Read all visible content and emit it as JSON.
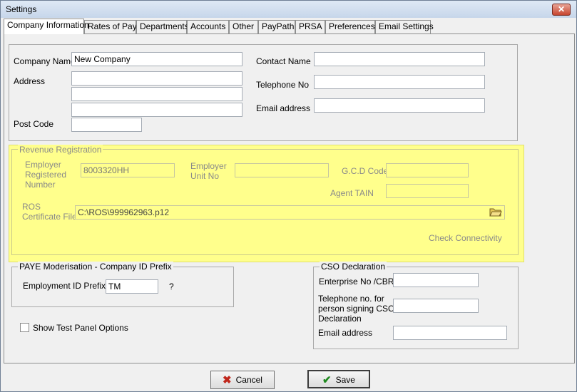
{
  "window": {
    "title": "Settings",
    "close_glyph": "✕"
  },
  "tabs": [
    "Company Information",
    "Rates of Pay",
    "Departments",
    "Accounts",
    "Other",
    "PayPath",
    "PRSA",
    "Preferences",
    "Email Settings"
  ],
  "company": {
    "name_label": "Company Name",
    "name_value": "New Company",
    "address_label": "Address",
    "postcode_label": "Post Code",
    "contact_label": "Contact Name",
    "telephone_label": "Telephone No",
    "email_label": "Email address"
  },
  "revenue": {
    "legend": "Revenue Registration",
    "employer_reg_label_1": "Employer",
    "employer_reg_label_2": "Registered",
    "employer_reg_label_3": "Number",
    "employer_reg_value": "8003320HH",
    "employer_unit_label_1": "Employer",
    "employer_unit_label_2": "Unit No",
    "gcd_label": "G.C.D Code",
    "agent_label": "Agent TAIN",
    "ros_label_1": "ROS",
    "ros_label_2": "Certificate File",
    "ros_value": "C:\\ROS\\999962963.p12",
    "check_connectivity": "Check Connectivity"
  },
  "paye": {
    "legend": "PAYE Moderisation  - Company ID Prefix",
    "prefix_label": "Employment ID Prefix",
    "prefix_value": "TM",
    "help": "?"
  },
  "cso": {
    "legend": "CSO Declaration",
    "enterprise_label": "Enterprise No /CBR",
    "tel_label_1": "Telephone no. for",
    "tel_label_2": "person signing CSO",
    "tel_label_3": "Declaration",
    "email_label": "Email address"
  },
  "options": {
    "show_test_panel": "Show Test Panel Options",
    "show_test_panel_checked": false
  },
  "buttons": {
    "cancel": "Cancel",
    "save": "Save"
  },
  "colors": {
    "highlight": "#ffff8c",
    "cancel_icon": "#c0271c",
    "save_icon": "#1f8a1f"
  }
}
